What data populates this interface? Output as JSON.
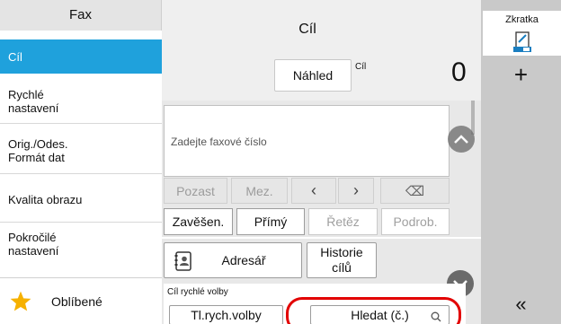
{
  "sidebar": {
    "header": "Fax",
    "items": [
      {
        "label": "Cíl",
        "active": true
      },
      {
        "label": "Rychlé\nnastavení"
      },
      {
        "label": "Orig./Odes.\nFormát dat"
      },
      {
        "label": "Kvalita obrazu"
      },
      {
        "label": "Pokročilé\nnastavení"
      }
    ],
    "favorites_label": "Oblíbené"
  },
  "main": {
    "title": "Cíl",
    "preview_label": "Náhled",
    "destination_small": "Cíl",
    "destination_count": "0",
    "fax_placeholder": "Zadejte faxové číslo",
    "keys": {
      "pause": "Pozast",
      "space": "Mez.",
      "left": "‹",
      "right": "›",
      "backspace": "⌫"
    },
    "options": {
      "onhook": "Zavěšen.",
      "direct": "Přímý",
      "chain": "Řetěz",
      "detail": "Podrob."
    },
    "address_book_label": "Adresář",
    "history_label": "Historie\ncílů",
    "speed_dial": {
      "label": "Cíl rychlé volby",
      "number_button": "Tl.rych.volby",
      "search_button": "Hledat (č.)"
    }
  },
  "shortcut_panel": {
    "title": "Zkratka",
    "add_label": "+",
    "collapse_label": "«"
  },
  "colors": {
    "accent": "#1fa1dc",
    "highlight_ring": "#e20000",
    "star": "#f6b100"
  }
}
